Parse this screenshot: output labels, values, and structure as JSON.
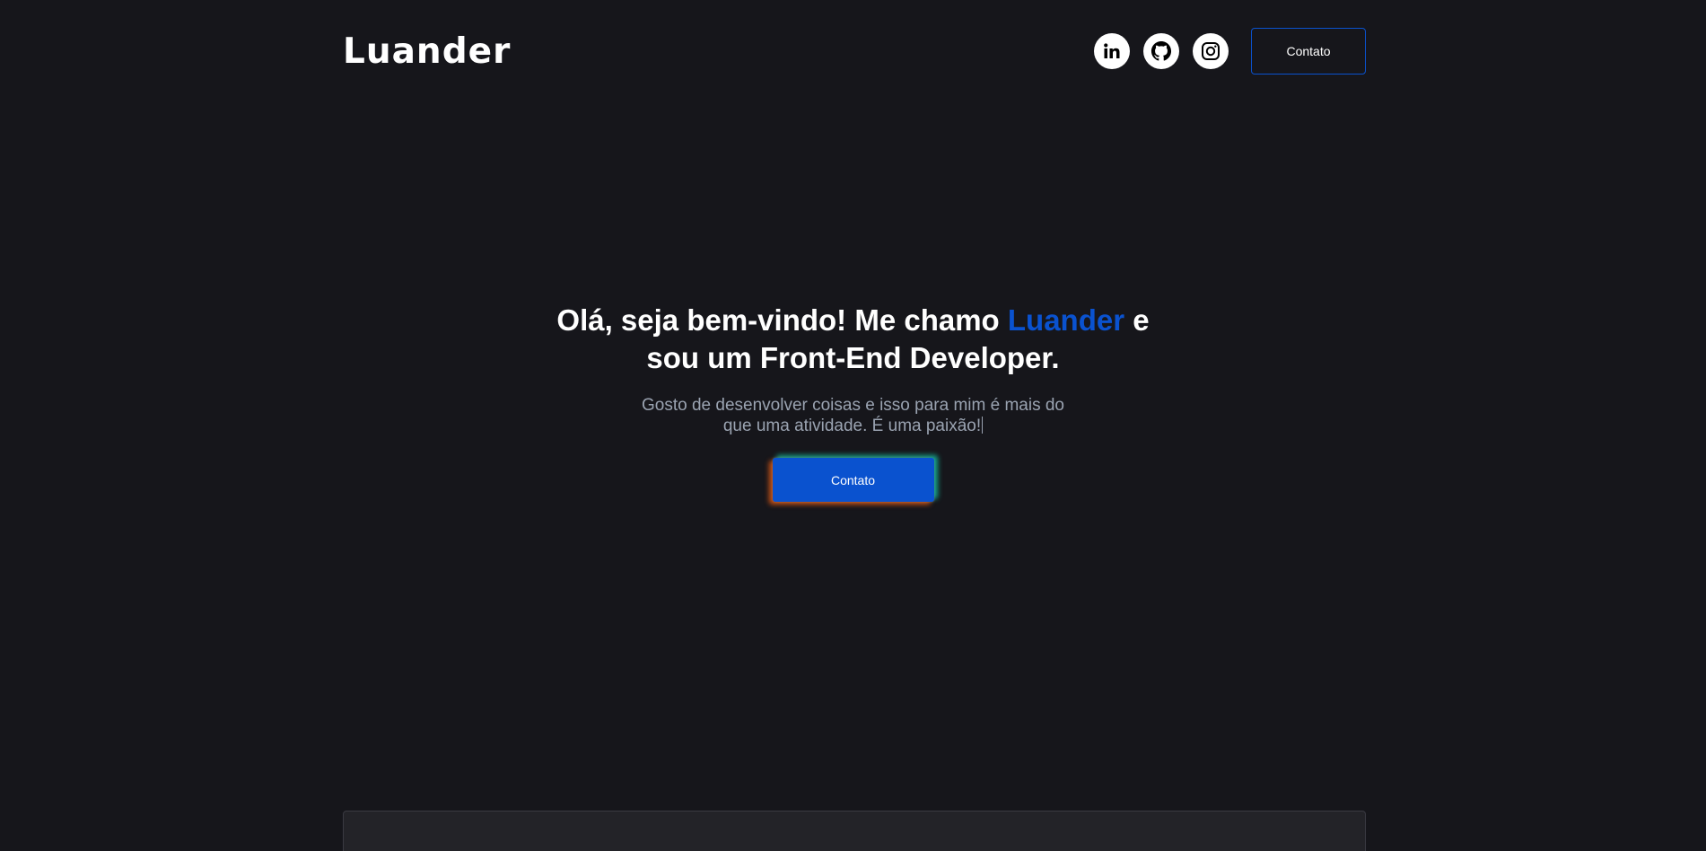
{
  "header": {
    "logo": "Luander",
    "social": [
      {
        "icon": "linkedin-icon"
      },
      {
        "icon": "github-icon"
      },
      {
        "icon": "instagram-icon"
      }
    ],
    "contact_label": "Contato"
  },
  "hero": {
    "title_before": "Olá, seja bem-vindo! Me chamo ",
    "title_name": "Luander",
    "title_after": " e sou um Front-End Developer.",
    "subtitle": "Gosto de desenvolver coisas e isso para mim é mais do que uma atividade. É uma paixão!",
    "button_label": "Contato"
  },
  "colors": {
    "background": "#16161b",
    "accent": "#0a52cf",
    "subtitle": "#9aa3b1"
  }
}
